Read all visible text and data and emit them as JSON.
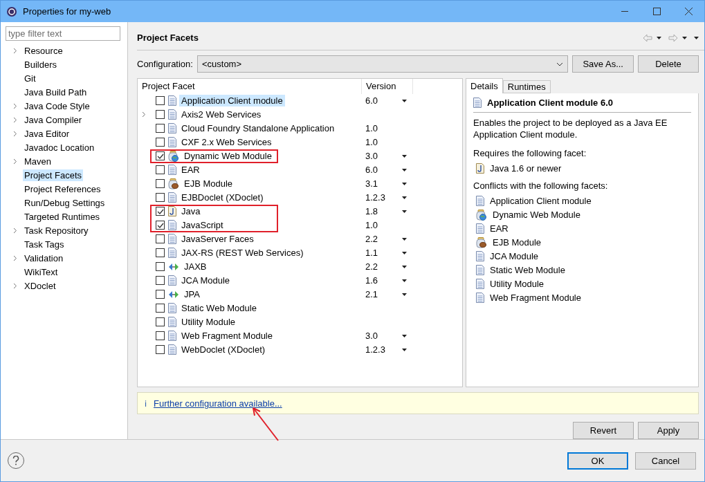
{
  "window": {
    "title": "Properties for my-web"
  },
  "filter": {
    "placeholder": "type filter text"
  },
  "sidebar": {
    "items": [
      {
        "label": "Resource",
        "expandable": true,
        "selected": false
      },
      {
        "label": "Builders",
        "expandable": false,
        "selected": false
      },
      {
        "label": "Git",
        "expandable": false,
        "selected": false
      },
      {
        "label": "Java Build Path",
        "expandable": false,
        "selected": false
      },
      {
        "label": "Java Code Style",
        "expandable": true,
        "selected": false
      },
      {
        "label": "Java Compiler",
        "expandable": true,
        "selected": false
      },
      {
        "label": "Java Editor",
        "expandable": true,
        "selected": false
      },
      {
        "label": "Javadoc Location",
        "expandable": false,
        "selected": false
      },
      {
        "label": "Maven",
        "expandable": true,
        "selected": false
      },
      {
        "label": "Project Facets",
        "expandable": false,
        "selected": true
      },
      {
        "label": "Project References",
        "expandable": false,
        "selected": false
      },
      {
        "label": "Run/Debug Settings",
        "expandable": false,
        "selected": false
      },
      {
        "label": "Targeted Runtimes",
        "expandable": false,
        "selected": false
      },
      {
        "label": "Task Repository",
        "expandable": true,
        "selected": false
      },
      {
        "label": "Task Tags",
        "expandable": false,
        "selected": false
      },
      {
        "label": "Validation",
        "expandable": true,
        "selected": false
      },
      {
        "label": "WikiText",
        "expandable": false,
        "selected": false
      },
      {
        "label": "XDoclet",
        "expandable": true,
        "selected": false
      }
    ]
  },
  "page": {
    "title": "Project Facets"
  },
  "configuration": {
    "label": "Configuration:",
    "value": "<custom>",
    "buttons": [
      "Save As...",
      "Delete"
    ]
  },
  "facets": {
    "columns": [
      "Project Facet",
      "Version"
    ],
    "rows": [
      {
        "name": "Application Client module",
        "kind": "doc",
        "version": "6.0",
        "dropdown": true,
        "checked": false,
        "selected": true,
        "expandable": false,
        "highlighted": false
      },
      {
        "name": "Axis2 Web Services",
        "kind": "doc",
        "checked": false,
        "selected": false,
        "expandable": true,
        "highlighted": false
      },
      {
        "name": "Cloud Foundry Standalone Application",
        "kind": "doc",
        "version": "1.0",
        "dropdown": false,
        "checked": false,
        "selected": false,
        "expandable": false,
        "highlighted": false
      },
      {
        "name": "CXF 2.x Web Services",
        "kind": "doc",
        "version": "1.0",
        "dropdown": false,
        "checked": false,
        "selected": false,
        "expandable": false,
        "highlighted": false
      },
      {
        "name": "Dynamic Web Module",
        "kind": "web",
        "version": "3.0",
        "dropdown": true,
        "checked": true,
        "selected": false,
        "expandable": false,
        "highlighted": true
      },
      {
        "name": "EAR",
        "kind": "doc",
        "version": "6.0",
        "dropdown": true,
        "checked": false,
        "selected": false,
        "expandable": false,
        "highlighted": false
      },
      {
        "name": "EJB Module",
        "kind": "ejb",
        "version": "3.1",
        "dropdown": true,
        "checked": false,
        "selected": false,
        "expandable": false,
        "highlighted": false
      },
      {
        "name": "EJBDoclet (XDoclet)",
        "kind": "doc",
        "version": "1.2.3",
        "dropdown": true,
        "checked": false,
        "selected": false,
        "expandable": false,
        "highlighted": false
      },
      {
        "name": "Java",
        "kind": "java",
        "version": "1.8",
        "dropdown": true,
        "checked": true,
        "selected": false,
        "expandable": false,
        "highlighted": true
      },
      {
        "name": "JavaScript",
        "kind": "doc",
        "version": "1.0",
        "dropdown": false,
        "checked": true,
        "selected": false,
        "expandable": false,
        "highlighted": true
      },
      {
        "name": "JavaServer Faces",
        "kind": "doc",
        "version": "2.2",
        "dropdown": true,
        "checked": false,
        "selected": false,
        "expandable": false,
        "highlighted": false
      },
      {
        "name": "JAX-RS (REST Web Services)",
        "kind": "doc",
        "version": "1.1",
        "dropdown": true,
        "checked": false,
        "selected": false,
        "expandable": false,
        "highlighted": false
      },
      {
        "name": "JAXB",
        "kind": "arrows",
        "version": "2.2",
        "dropdown": true,
        "checked": false,
        "selected": false,
        "expandable": false,
        "highlighted": false
      },
      {
        "name": "JCA Module",
        "kind": "doc",
        "version": "1.6",
        "dropdown": true,
        "checked": false,
        "selected": false,
        "expandable": false,
        "highlighted": false
      },
      {
        "name": "JPA",
        "kind": "arrows",
        "version": "2.1",
        "dropdown": true,
        "checked": false,
        "selected": false,
        "expandable": false,
        "highlighted": false
      },
      {
        "name": "Static Web Module",
        "kind": "doc",
        "checked": false,
        "selected": false,
        "expandable": false,
        "highlighted": false
      },
      {
        "name": "Utility Module",
        "kind": "doc",
        "checked": false,
        "selected": false,
        "expandable": false,
        "highlighted": false
      },
      {
        "name": "Web Fragment Module",
        "kind": "doc",
        "version": "3.0",
        "dropdown": true,
        "checked": false,
        "selected": false,
        "expandable": false,
        "highlighted": false
      },
      {
        "name": "WebDoclet (XDoclet)",
        "kind": "doc",
        "version": "1.2.3",
        "dropdown": true,
        "checked": false,
        "selected": false,
        "expandable": false,
        "highlighted": false
      }
    ]
  },
  "details": {
    "tabs": [
      {
        "label": "Details",
        "selected": true
      },
      {
        "label": "Runtimes",
        "selected": false
      }
    ],
    "heading": {
      "text": "Application Client module 6.0",
      "kind": "doc"
    },
    "description": "Enables the project to be deployed as a Java EE Application Client module.",
    "requires_label": "Requires the following facet:",
    "requires": [
      {
        "label": "Java 1.6 or newer",
        "kind": "java"
      }
    ],
    "conflicts_label": "Conflicts with the following facets:",
    "conflicts": [
      {
        "label": "Application Client module",
        "kind": "doc"
      },
      {
        "label": "Dynamic Web Module",
        "kind": "web"
      },
      {
        "label": "EAR",
        "kind": "doc"
      },
      {
        "label": "EJB Module",
        "kind": "ejb"
      },
      {
        "label": "JCA Module",
        "kind": "doc"
      },
      {
        "label": "Static Web Module",
        "kind": "doc"
      },
      {
        "label": "Utility Module",
        "kind": "doc"
      },
      {
        "label": "Web Fragment Module",
        "kind": "doc"
      }
    ]
  },
  "info_bar": {
    "icon": "ℹ",
    "link": "Further configuration available...",
    "annotation_arrow": true
  },
  "page_buttons": [
    "Revert",
    "Apply"
  ],
  "dialog_buttons": [
    {
      "label": "OK",
      "default": true
    },
    {
      "label": "Cancel",
      "default": false
    }
  ]
}
